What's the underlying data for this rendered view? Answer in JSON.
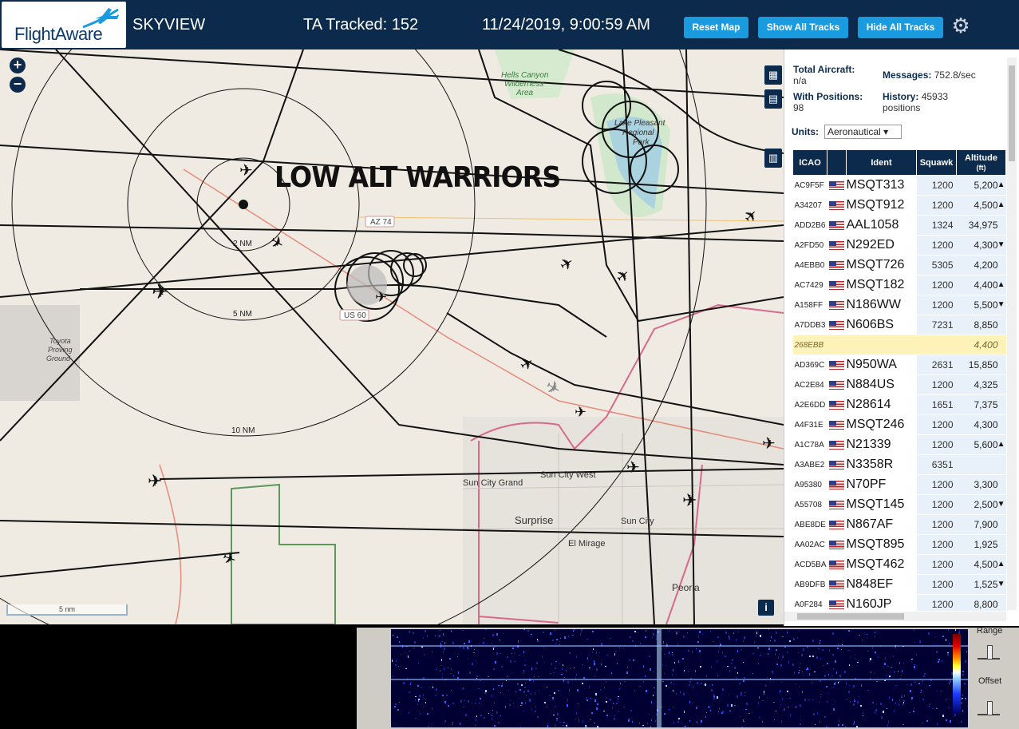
{
  "header": {
    "logo": "FlightAware",
    "title": "SKYVIEW",
    "tracked": "TA Tracked: 152",
    "datetime": "11/24/2019, 9:00:59 AM",
    "buttons": {
      "reset": "Reset Map",
      "show": "Show All Tracks",
      "hide": "Hide All Tracks"
    }
  },
  "map": {
    "overlay_text": "LOW ALT WARRIORS",
    "range_rings": [
      "2 NM",
      "5 NM",
      "10 NM"
    ],
    "labels": {
      "hells": "Hells Canyon\nWilderness\nArea",
      "lake": "Lake Pleasant\nRegional\nPark",
      "toyota": "Toyota\nProving\nGround",
      "az74": "AZ 74",
      "us60": "US 60",
      "sun_city_grand": "Sun City Grand",
      "sun_city_west": "Sun City West",
      "surprise": "Surprise",
      "sun_city": "Sun City",
      "el_mirage": "El Mirage",
      "peoria": "Peoria"
    },
    "scale": "5 nm"
  },
  "sidebar": {
    "total_label": "Total Aircraft:",
    "total_value": "n/a",
    "positions_label": "With Positions:",
    "positions_value": "98",
    "messages_label": "Messages:",
    "messages_value": "752.8/sec",
    "history_label": "History:",
    "history_value": "45933",
    "history_unit": "positions",
    "units_label": "Units:",
    "units_value": "Aeronautical",
    "columns": {
      "icao": "ICAO",
      "ident": "Ident",
      "squawk": "Squawk",
      "altitude": "Altitude",
      "altitude_unit": "(ft)"
    },
    "rows": [
      {
        "icao": "AC9F5F",
        "flag": true,
        "ident": "MSQT313",
        "squawk": "1200",
        "alt": "5,200",
        "trend": "▲"
      },
      {
        "icao": "A34207",
        "flag": true,
        "ident": "MSQT912",
        "squawk": "1200",
        "alt": "4,500",
        "trend": "▲"
      },
      {
        "icao": "ADD2B6",
        "flag": true,
        "ident": "AAL1058",
        "squawk": "1324",
        "alt": "34,975",
        "trend": ""
      },
      {
        "icao": "A2FD50",
        "flag": true,
        "ident": "N292ED",
        "squawk": "1200",
        "alt": "4,300",
        "trend": "▼"
      },
      {
        "icao": "A4EBB0",
        "flag": true,
        "ident": "MSQT726",
        "squawk": "5305",
        "alt": "4,200",
        "trend": ""
      },
      {
        "icao": "AC7429",
        "flag": true,
        "ident": "MSQT182",
        "squawk": "1200",
        "alt": "4,400",
        "trend": "▲"
      },
      {
        "icao": "A158FF",
        "flag": true,
        "ident": "N186WW",
        "squawk": "1200",
        "alt": "5,500",
        "trend": "▼"
      },
      {
        "icao": "A7DDB3",
        "flag": true,
        "ident": "N606BS",
        "squawk": "7231",
        "alt": "8,850",
        "trend": ""
      },
      {
        "icao": "268EBB",
        "flag": false,
        "ident": "",
        "squawk": "",
        "alt": "4,400",
        "trend": "",
        "selected": true
      },
      {
        "icao": "AD369C",
        "flag": true,
        "ident": "N950WA",
        "squawk": "2631",
        "alt": "15,850",
        "trend": ""
      },
      {
        "icao": "AC2E84",
        "flag": true,
        "ident": "N884US",
        "squawk": "1200",
        "alt": "4,325",
        "trend": ""
      },
      {
        "icao": "A2E6DD",
        "flag": true,
        "ident": "N28614",
        "squawk": "1651",
        "alt": "7,375",
        "trend": ""
      },
      {
        "icao": "A4F31E",
        "flag": true,
        "ident": "MSQT246",
        "squawk": "1200",
        "alt": "4,300",
        "trend": ""
      },
      {
        "icao": "A1C78A",
        "flag": true,
        "ident": "N21339",
        "squawk": "1200",
        "alt": "5,600",
        "trend": "▲"
      },
      {
        "icao": "A3ABE2",
        "flag": true,
        "ident": "N3358R",
        "squawk": "6351",
        "alt": "",
        "trend": ""
      },
      {
        "icao": "A95380",
        "flag": true,
        "ident": "N70PF",
        "squawk": "1200",
        "alt": "3,300",
        "trend": ""
      },
      {
        "icao": "A55708",
        "flag": true,
        "ident": "MSQT145",
        "squawk": "1200",
        "alt": "2,500",
        "trend": "▼"
      },
      {
        "icao": "ABE8DE",
        "flag": true,
        "ident": "N867AF",
        "squawk": "1200",
        "alt": "7,900",
        "trend": ""
      },
      {
        "icao": "AA02AC",
        "flag": true,
        "ident": "MSQT895",
        "squawk": "1200",
        "alt": "1,925",
        "trend": ""
      },
      {
        "icao": "ACD5BA",
        "flag": true,
        "ident": "MSQT462",
        "squawk": "1200",
        "alt": "4,500",
        "trend": "▲"
      },
      {
        "icao": "AB9DFB",
        "flag": true,
        "ident": "N848EF",
        "squawk": "1200",
        "alt": "1,525",
        "trend": "▼"
      },
      {
        "icao": "A0F284",
        "flag": true,
        "ident": "N160JP",
        "squawk": "1200",
        "alt": "8,800",
        "trend": ""
      }
    ]
  },
  "waterfall": {
    "range_label": "Range",
    "offset_label": "Offset"
  }
}
